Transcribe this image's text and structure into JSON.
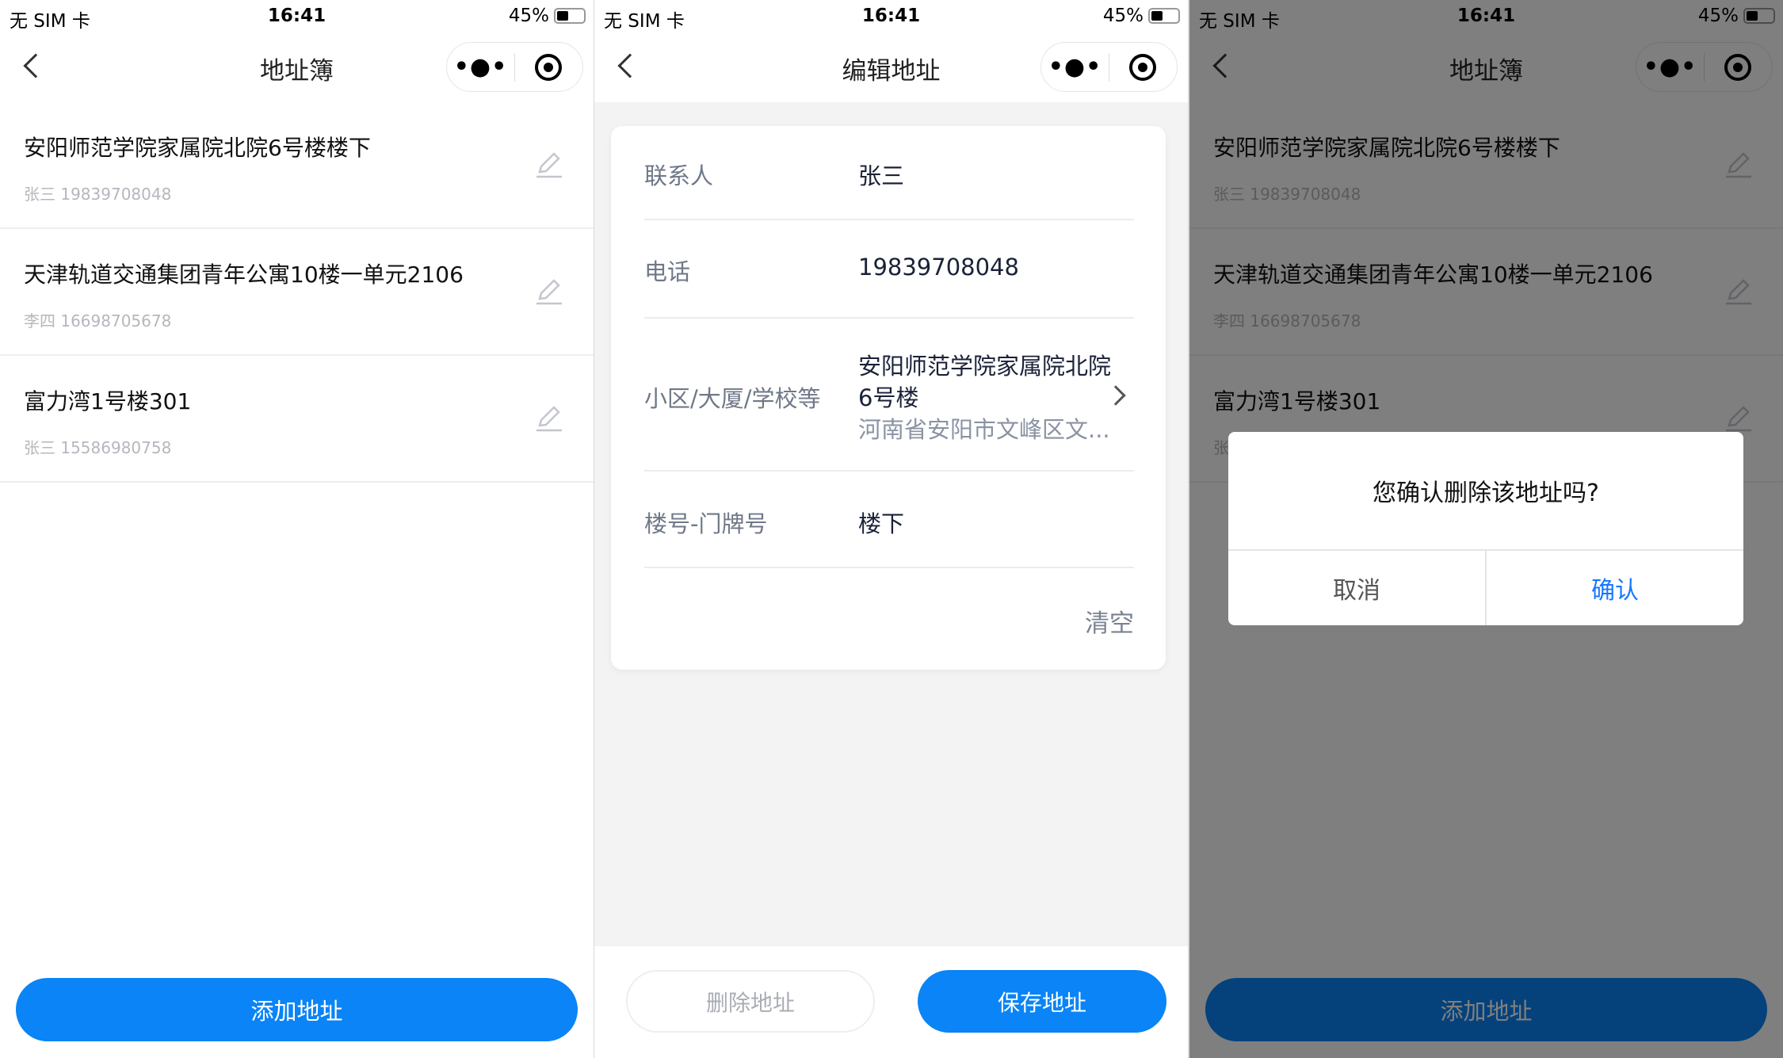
{
  "status": {
    "carrier": "无 SIM 卡",
    "time": "16:41",
    "battery": "45%"
  },
  "capsule": {
    "more": "•●•"
  },
  "list": {
    "title": "地址簿",
    "items": [
      {
        "address": "安阳师范学院家属院北院6号楼楼下",
        "contact": "张三 19839708048"
      },
      {
        "address": "天津轨道交通集团青年公寓10楼一单元2106",
        "contact": "李四 16698705678"
      },
      {
        "address": "富力湾1号楼301",
        "contact": "张三 15586980758"
      }
    ],
    "add_label": "添加地址"
  },
  "edit": {
    "title": "编辑地址",
    "contact_label": "联系人",
    "contact_value": "张三",
    "phone_label": "电话",
    "phone_value": "19839708048",
    "place_label": "小区/大厦/学校等",
    "place_line1": "安阳师范学院家属院北院",
    "place_line2": "6号楼",
    "place_region": "河南省安阳市文峰区文...",
    "door_label": "楼号-门牌号",
    "door_value": "楼下",
    "clear_label": "清空",
    "delete_label": "删除地址",
    "save_label": "保存地址"
  },
  "dialog": {
    "message": "您确认删除该地址吗?",
    "cancel": "取消",
    "confirm": "确认"
  },
  "colors": {
    "primary": "#0a84f7",
    "confirm": "#1677ff"
  }
}
